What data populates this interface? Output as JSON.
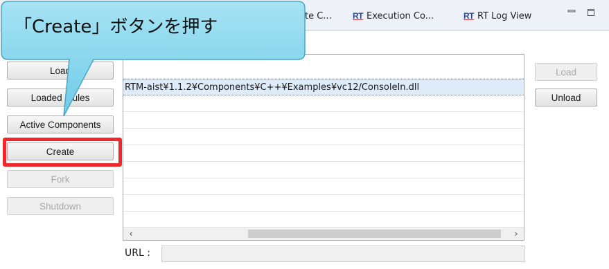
{
  "tabs": [
    {
      "label": "te C..."
    },
    {
      "label": "Execution Co..."
    },
    {
      "label": "RT Log View"
    }
  ],
  "rt_icon_text": "RT",
  "left_buttons": [
    {
      "label": "Load",
      "enabled": true
    },
    {
      "label": "Loaded ...ules",
      "enabled": true
    },
    {
      "label": "Active Components",
      "enabled": true
    },
    {
      "label": "Create",
      "enabled": true
    },
    {
      "label": "Fork",
      "enabled": false
    },
    {
      "label": "Shutdown",
      "enabled": false
    }
  ],
  "right_buttons": {
    "load": {
      "label": "Load",
      "enabled": false
    },
    "unload": {
      "label": "Unload",
      "enabled": true
    }
  },
  "modules_list": {
    "rows": [
      "",
      "RTM-aist¥1.1.2¥Components¥C++¥Examples¥vc12/ConsoleIn.dll",
      "",
      "",
      "",
      "",
      "",
      "",
      "",
      ""
    ],
    "selected_index": 1
  },
  "url": {
    "label": "URL :",
    "value": ""
  },
  "callout": {
    "text": "「Create」ボタンを押す"
  },
  "colors": {
    "highlight": "#f0282d",
    "callout_fill": "#7fd3ec"
  }
}
